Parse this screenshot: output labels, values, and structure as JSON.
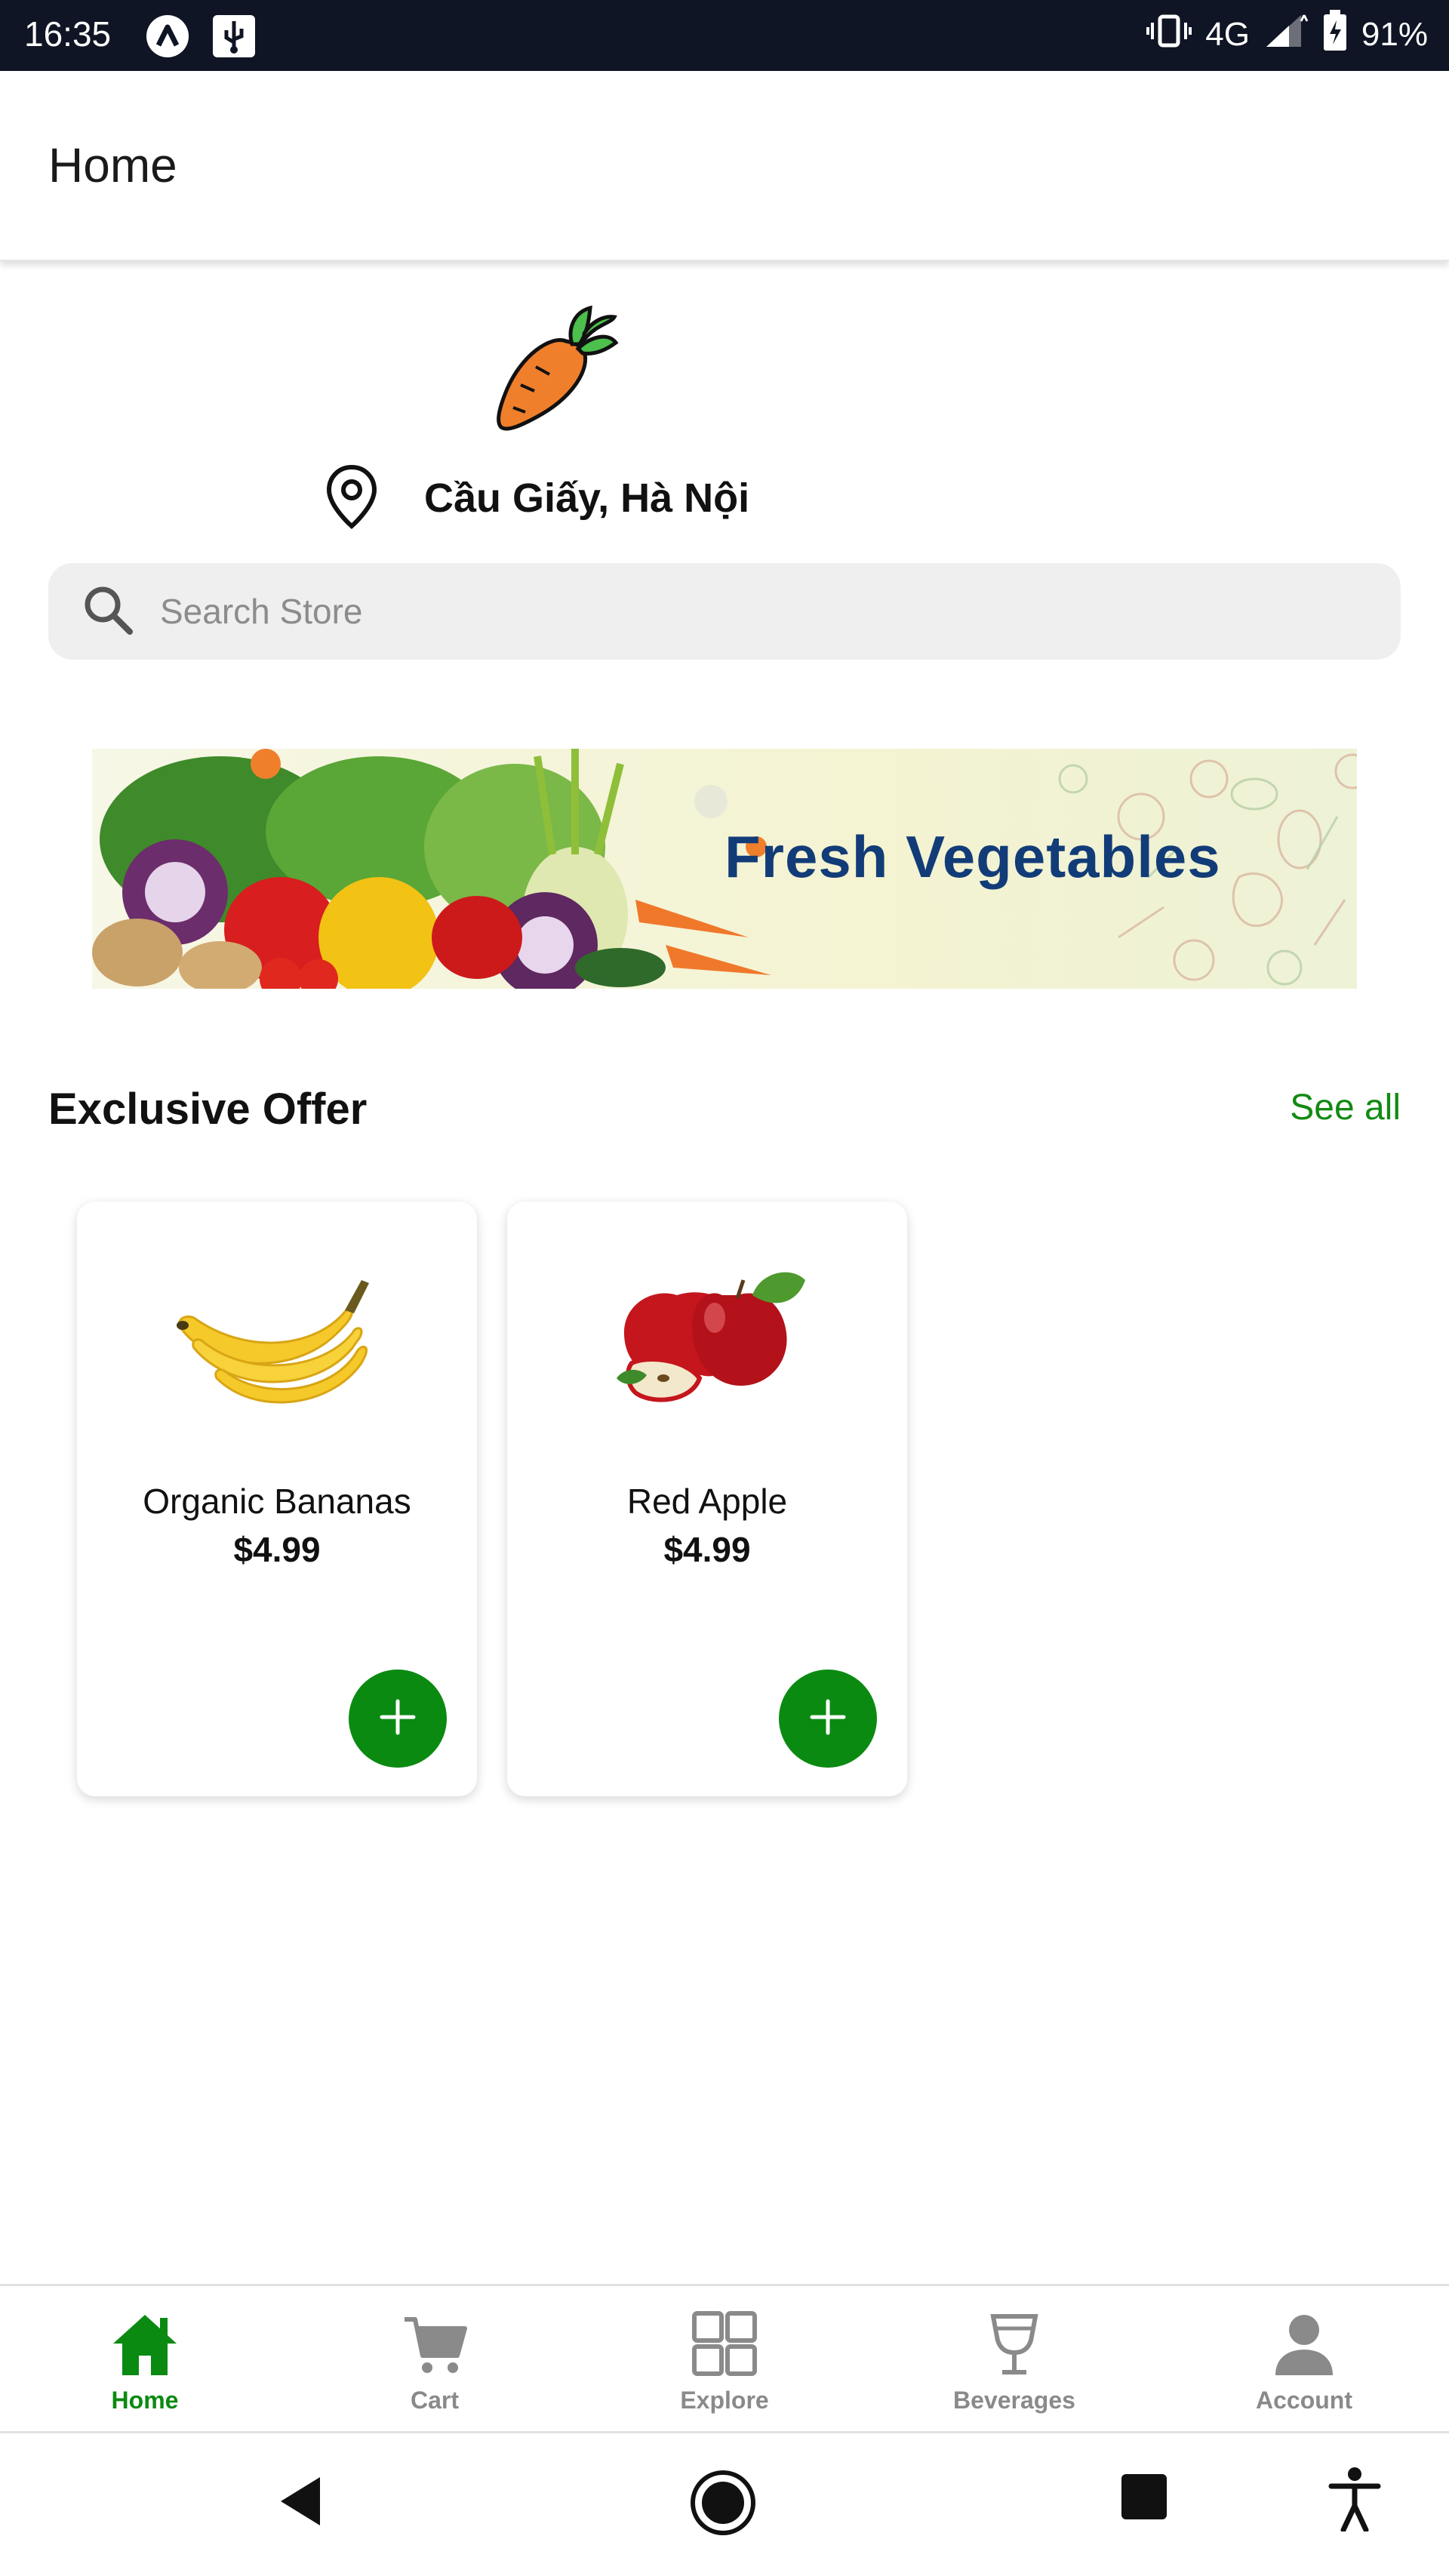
{
  "status_bar": {
    "time": "16:35",
    "network": "4G",
    "battery": "91%",
    "icons": [
      "a-icon",
      "usb-icon",
      "vibrate-icon",
      "signal-icon",
      "battery-icon"
    ]
  },
  "app_bar": {
    "title": "Home"
  },
  "header": {
    "logo_icon": "carrot-icon",
    "location_icon": "location-pin-icon",
    "location": "Cầu Giấy, Hà Nội"
  },
  "search": {
    "placeholder": "Search Store",
    "value": "",
    "icon": "search-icon"
  },
  "banner": {
    "title": "Fresh Vegetables"
  },
  "exclusive_offer": {
    "title": "Exclusive Offer",
    "see_all": "See all",
    "products": [
      {
        "name": "Organic Bananas",
        "price": "$4.99",
        "image_icon": "banana-icon"
      },
      {
        "name": "Red Apple",
        "price": "$4.99",
        "image_icon": "apple-icon"
      }
    ]
  },
  "bottom_nav": {
    "items": [
      {
        "label": "Home",
        "icon": "home-icon",
        "active": true
      },
      {
        "label": "Cart",
        "icon": "cart-icon",
        "active": false
      },
      {
        "label": "Explore",
        "icon": "grid-icon",
        "active": false
      },
      {
        "label": "Beverages",
        "icon": "glass-icon",
        "active": false
      },
      {
        "label": "Account",
        "icon": "person-icon",
        "active": false
      }
    ]
  },
  "colors": {
    "accent": "#0b8a12",
    "status_bar": "#0f1524",
    "banner_text": "#123c78"
  }
}
